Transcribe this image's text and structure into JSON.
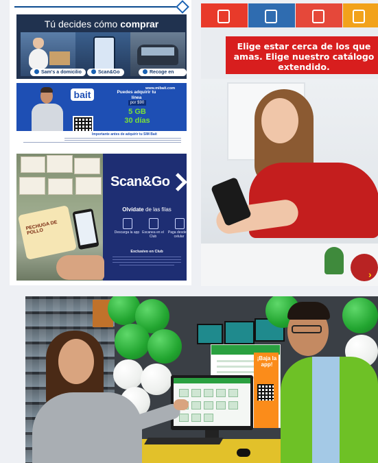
{
  "left_card": {
    "panel1": {
      "title_regular": "Tú decides cómo ",
      "title_bold": "comprar",
      "pill1": "Sam's a domicilio",
      "pill2": "Scan&Go",
      "pill3": "Recoge en Club"
    },
    "panel2": {
      "logo": "bait",
      "url": "www.mibait.com",
      "headline": "Puedes adquirir tu línea",
      "price": "por $90",
      "gb": "5 GB",
      "days": "30 días",
      "footer_title": "Importante antes de adquirir tu SIM Bait"
    },
    "panel3": {
      "package_label": "PECHUGA DE POLLO",
      "brand": "Scan&Go",
      "subtitle_bold": "Olvídate",
      "subtitle_rest": " de las filas",
      "icon_labels": [
        "Descarga la app",
        "Escanea en el Club",
        "Paga desde tu celular"
      ],
      "exclusive": "Exclusivo en Club"
    }
  },
  "right_card": {
    "banner_text": "Elige estar cerca de los que amas. Elige nuestro catálogo extendido.",
    "tabs": [
      {
        "icon": "phone-icon",
        "color": "#e83a2a"
      },
      {
        "icon": "building-icon",
        "color": "#2f6cb0"
      },
      {
        "icon": "car-icon",
        "color": "#e5483a"
      },
      {
        "icon": "home-icon",
        "color": "#f2a21b"
      }
    ],
    "next_arrow": "›"
  },
  "bottom_photo": {
    "promo_card_text": "¡Baja la app!"
  },
  "colors": {
    "sams_blue": "#0b4a8f",
    "bait_blue": "#1e4fb4",
    "scango_navy": "#1e2e73",
    "banner_red": "#d81e1e",
    "vest_green": "#6ec126"
  }
}
